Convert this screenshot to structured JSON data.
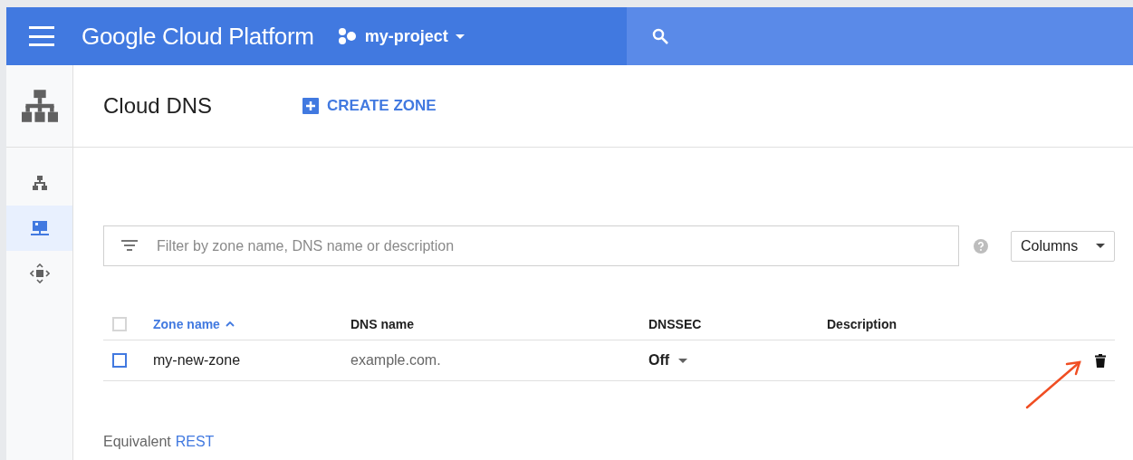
{
  "header": {
    "product": "Google Cloud Platform",
    "project": "my-project"
  },
  "sidebar": {
    "items": [
      {
        "kind": "network",
        "selected": false
      },
      {
        "kind": "zone",
        "selected": true
      },
      {
        "kind": "move",
        "selected": false
      }
    ]
  },
  "page": {
    "title": "Cloud DNS",
    "action": "CREATE ZONE"
  },
  "filter": {
    "placeholder": "Filter by zone name, DNS name or description"
  },
  "columns_button": "Columns",
  "table": {
    "select_all_checked": false,
    "columns": [
      {
        "label": "Zone name",
        "sorted": true
      },
      {
        "label": "DNS name",
        "sorted": false
      },
      {
        "label": "DNSSEC",
        "sorted": false
      },
      {
        "label": "Description",
        "sorted": false
      }
    ],
    "rows": [
      {
        "checked": false,
        "zone_name": "my-new-zone",
        "dns_name": "example.com.",
        "dnssec": "Off"
      }
    ]
  },
  "footer": {
    "prefix": "Equivalent",
    "link": "REST"
  }
}
